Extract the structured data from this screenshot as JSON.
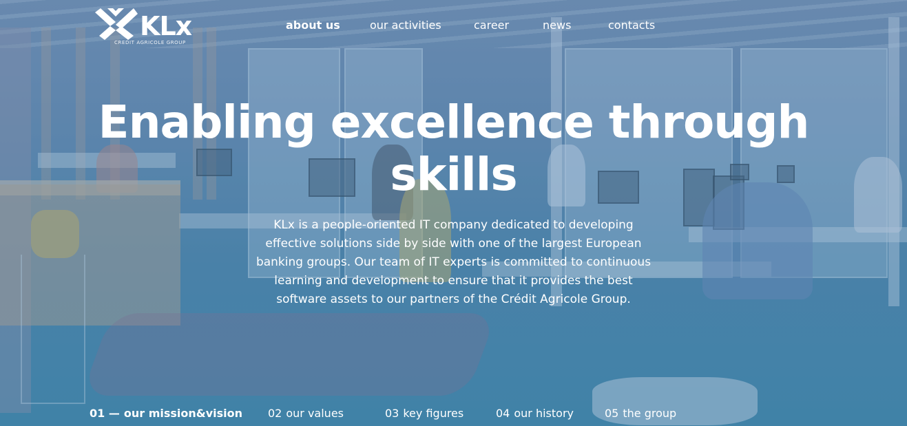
{
  "brand": {
    "name": "KLx",
    "subtitle": "CREDIT AGRICOLE GROUP"
  },
  "nav": {
    "items": [
      {
        "label": "about us",
        "active": true
      },
      {
        "label": "our activities",
        "active": false
      },
      {
        "label": "career",
        "active": false
      },
      {
        "label": "news",
        "active": false
      },
      {
        "label": "contacts",
        "active": false
      }
    ]
  },
  "hero": {
    "title_line1": "Enabling excellence through",
    "title_line2": "skills",
    "description": "KLx is a people-oriented IT company dedicated to developing effective solutions side by side with one of the largest European banking groups. Our team of IT experts is committed to continuous learning and development to ensure that it provides the best software assets to our partners of the Crédit Agricole Group."
  },
  "tabs": [
    {
      "num": "01 —",
      "label": "our mission&vision",
      "active": true
    },
    {
      "num": "02",
      "label": "our values",
      "active": false
    },
    {
      "num": "03",
      "label": "key figures",
      "active": false
    },
    {
      "num": "04",
      "label": "our history",
      "active": false
    },
    {
      "num": "05",
      "label": "the group",
      "active": false
    }
  ],
  "colors": {
    "overlay": "#4f86aa",
    "text": "#ffffff"
  }
}
